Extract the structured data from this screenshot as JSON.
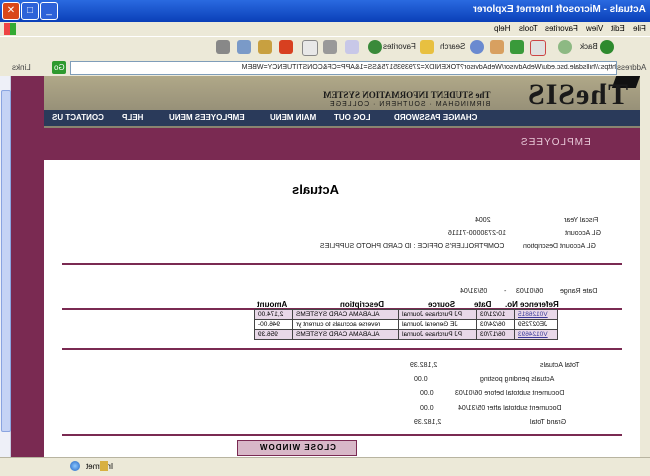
{
  "window": {
    "title": "Actuals - Microsoft Internet Explorer",
    "min": "_",
    "max": "□",
    "close": "✕"
  },
  "menu": {
    "items": [
      "File",
      "Edit",
      "View",
      "Favorites",
      "Tools",
      "Help"
    ]
  },
  "toolbar": {
    "back": "Back",
    "search": "Search",
    "favorites": "Favorites"
  },
  "address": {
    "label": "Address",
    "url": "https://hillsdale.bsc.edu/WebAdvisor/WebAdvisor?TOKENIDX=2793935175&SS=1&APP=CF&CONSTITUENCY=WBEM",
    "go": "Go",
    "links": "Links"
  },
  "header": {
    "logo": "TheSIS",
    "subtitle": "The STUDENT INFORMATION SYSTEM",
    "subtitle2": "BIRMINGHAM · SOUTHERN · COLLEGE",
    "nav": [
      "CONTACT US",
      "HELP",
      "EMPLOYEES MENU",
      "MAIN MENU",
      "LOG OUT",
      "CHANGE PASSWORD"
    ]
  },
  "section_title": "EMPLOYEES",
  "page_title": "Actuals",
  "fiscal": {
    "fiscal_year_label": "Fiscal Year",
    "fiscal_year": "2004",
    "gl_account_label": "GL Account",
    "gl_account": "10-2730000-71116",
    "gl_desc_label": "GL Account Description",
    "gl_desc": "COMPTROLLER'S OFFICE : ID CARD PHOTO SUPPLIES"
  },
  "date_range": {
    "label": "Date Range",
    "from": "06/01/03",
    "sep": "-",
    "to": "05/31/04"
  },
  "table": {
    "headers": [
      "Reference No.",
      "Date",
      "Source",
      "Description",
      "Amount"
    ],
    "rows": [
      [
        "V0126815",
        "10/21/03",
        "PJ Purchase Journal",
        "ALABAMA CARD SYSTEMS",
        "2,174.00"
      ],
      [
        "JE027259",
        "06/24/03",
        "JE General Journal",
        "reverse accruals to current yr",
        "946.00-"
      ],
      [
        "V0124693",
        "06/17/03",
        "PJ Purchase Journal",
        "ALABAMA CARD SYSTEMS",
        "956.39"
      ]
    ]
  },
  "totals": {
    "total_actuals_label": "Total Actuals",
    "total_actuals": "2,182.39",
    "pending_label": "Actuals pending posting",
    "pending": "0.00",
    "sub_before_label": "Document subtotal before 06/01/03",
    "sub_before": "0.00",
    "sub_after_label": "Document subtotal after 05/31/04",
    "sub_after": "0.00",
    "grand_label": "Grand Total",
    "grand": "2,182.39"
  },
  "close_window": "CLOSE WINDOW",
  "status": {
    "zone": "Internet"
  }
}
